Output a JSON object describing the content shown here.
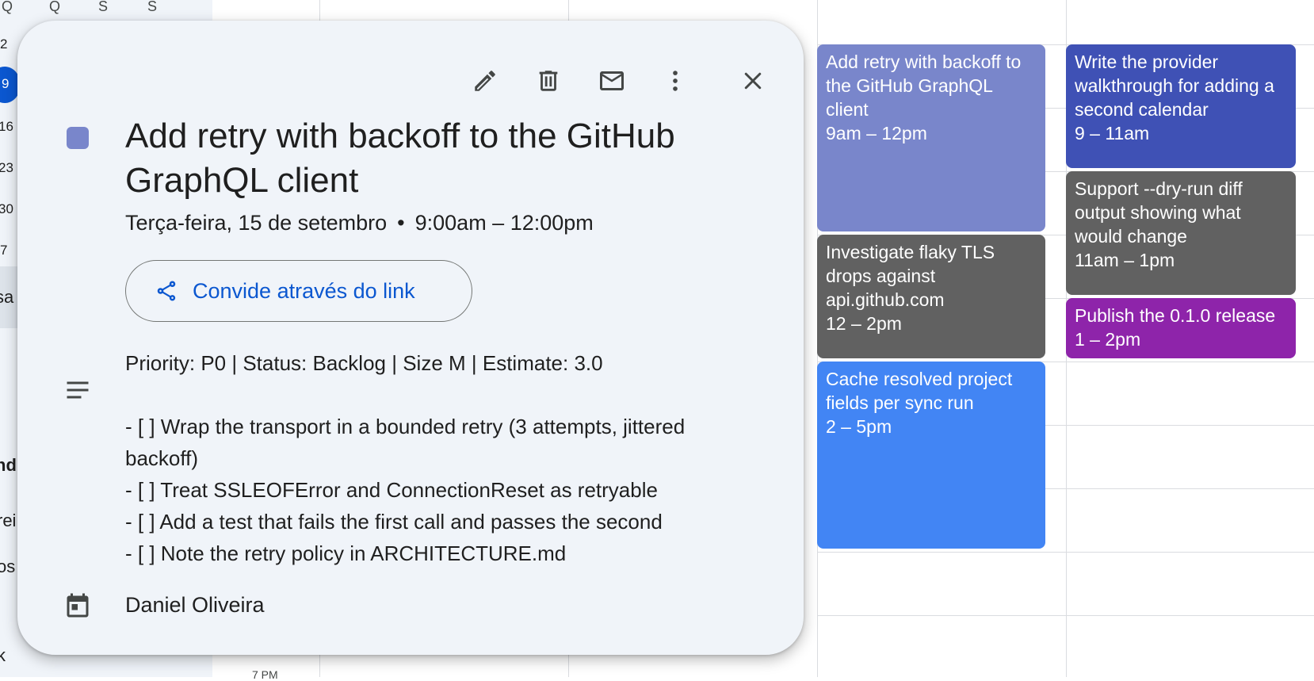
{
  "mini_calendar": {
    "weekday_headers": [
      "Q",
      "Q",
      "S",
      "S"
    ],
    "days": [
      "2",
      "9",
      "16",
      "23",
      "30",
      "7"
    ],
    "today": "9",
    "fragments": [
      "sa",
      "nd",
      "rei",
      "os",
      "k"
    ]
  },
  "grid": {
    "hour_label": "7 PM"
  },
  "events": [
    {
      "title": "Add retry with backoff to the GitHub GraphQL client",
      "time": "9am – 12pm",
      "color": "#7986cb"
    },
    {
      "title": "Investigate flaky TLS drops against api.github.com",
      "time": "12 – 2pm",
      "color": "#616161"
    },
    {
      "title": "Cache resolved project fields per sync run",
      "time": "2 – 5pm",
      "color": "#4285f4"
    },
    {
      "title": "Write the provider walkthrough for adding a second calendar",
      "time": "9 – 11am",
      "color": "#3f51b5"
    },
    {
      "title": "Support --dry-run diff output showing what would change",
      "time": "11am – 1pm",
      "color": "#616161"
    },
    {
      "title": "Publish the 0.1.0 release",
      "time": "1 – 2pm",
      "color": "#8e24aa"
    }
  ],
  "card": {
    "icons": [
      "pencil-icon",
      "trash-icon",
      "mail-icon",
      "more-vert-icon",
      "close-icon"
    ],
    "swatch_color": "#7986cb",
    "title": "Add retry with backoff to the GitHub GraphQL client",
    "date": "Terça-feira, 15 de setembro",
    "separator": "•",
    "time": "9:00am – 12:00pm",
    "share_label": "Convide através do link",
    "description": [
      "Priority: P0 | Status: Backlog | Size M | Estimate: 3.0",
      "",
      "- [ ] Wrap the transport in a bounded retry (3 attempts, jittered backoff)",
      "- [ ] Treat SSLEOFError and ConnectionReset as retryable",
      "- [ ] Add a test that fails the first call and passes the second",
      "- [ ] Note the retry policy in ARCHITECTURE.md"
    ],
    "owner": "Daniel Oliveira"
  }
}
